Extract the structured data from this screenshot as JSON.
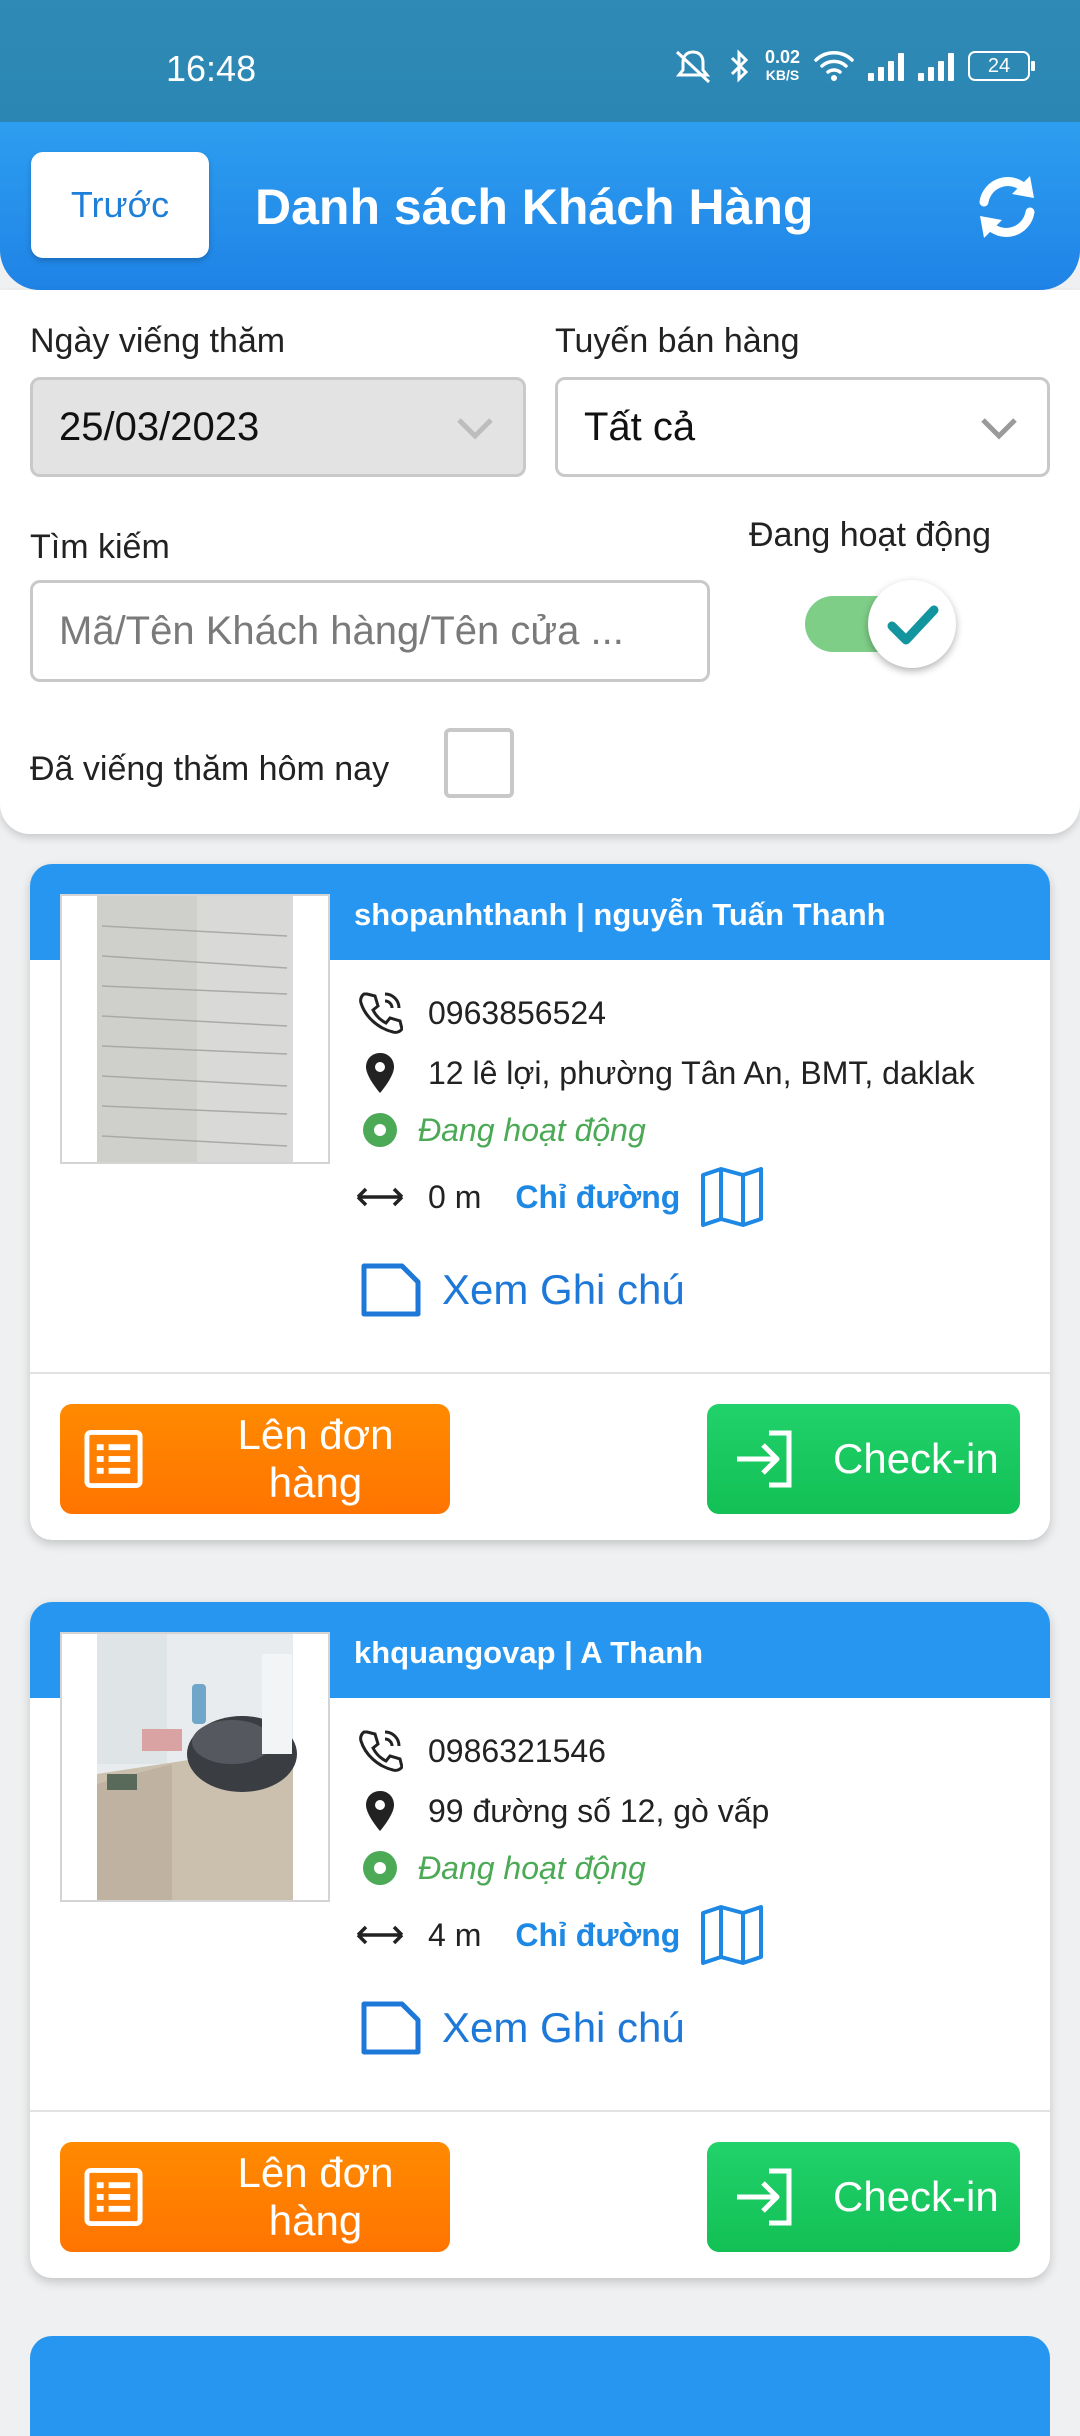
{
  "status_bar": {
    "time": "16:48",
    "net_speed_value": "0.02",
    "net_speed_unit": "KB/S",
    "battery": "24"
  },
  "header": {
    "back_label": "Trước",
    "title": "Danh sách Khách Hàng",
    "refresh_icon": "refresh-icon"
  },
  "filters": {
    "visit_date_label": "Ngày viếng thăm",
    "visit_date_value": "25/03/2023",
    "route_label": "Tuyến bán hàng",
    "route_value": "Tất cả",
    "search_label": "Tìm kiếm",
    "search_placeholder": "Mã/Tên Khách hàng/Tên cửa ...",
    "active_label": "Đang hoạt động",
    "active_on": true,
    "visited_today_label": "Đã viếng thăm hôm nay",
    "visited_today_checked": false
  },
  "customers": [
    {
      "name": "shopanhthanh | nguyễn Tuấn Thanh",
      "phone": "0963856524",
      "address": "12 lê lợi, phường Tân An, BMT, daklak",
      "status": "Đang hoạt động",
      "distance": "0 m",
      "directions_label": "Chỉ đường",
      "note_label": "Xem Ghi chú",
      "order_label": "Lên đơn hàng",
      "checkin_label": "Check-in"
    },
    {
      "name": "khquangovap | A Thanh",
      "phone": "0986321546",
      "address": "99 đường số 12, gò vấp",
      "status": "Đang hoạt động",
      "distance": "4 m",
      "directions_label": "Chỉ đường",
      "note_label": "Xem Ghi chú",
      "order_label": "Lên đơn hàng",
      "checkin_label": "Check-in"
    }
  ],
  "colors": {
    "header_blue": "#1f83e6",
    "card_head_blue": "#2696f0",
    "active_green": "#4caa57",
    "order_orange": "#ff7f00",
    "checkin_green": "#18c85e"
  }
}
